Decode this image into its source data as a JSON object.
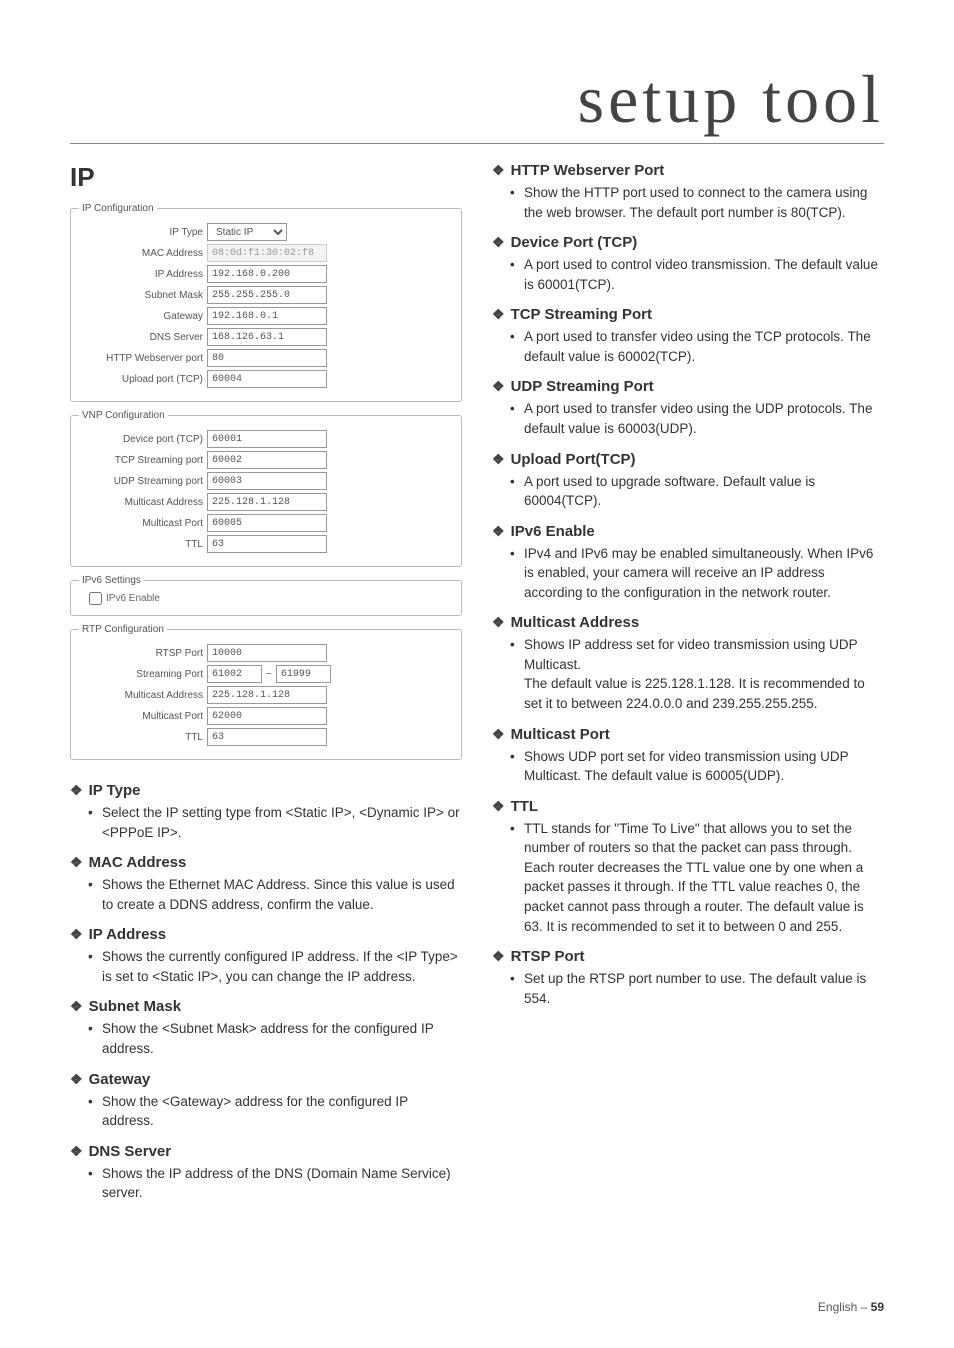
{
  "header": {
    "title": "setup tool"
  },
  "left": {
    "section_title": "IP",
    "ip_config": {
      "legend": "IP Configuration",
      "ip_type_label": "IP Type",
      "ip_type_value": "Static IP",
      "mac_label": "MAC Address",
      "mac_value": "08:0d:f1:30:02:f8",
      "ip_addr_label": "IP Address",
      "ip_addr_value": "192.168.0.200",
      "subnet_label": "Subnet Mask",
      "subnet_value": "255.255.255.0",
      "gateway_label": "Gateway",
      "gateway_value": "192.168.0.1",
      "dns_label": "DNS Server",
      "dns_value": "168.126.63.1",
      "http_label": "HTTP Webserver port",
      "http_value": "80",
      "upload_label": "Upload port (TCP)",
      "upload_value": "60004"
    },
    "vnp_config": {
      "legend": "VNP Configuration",
      "device_port_label": "Device port (TCP)",
      "device_port_value": "60001",
      "tcp_stream_label": "TCP Streaming port",
      "tcp_stream_value": "60002",
      "udp_stream_label": "UDP Streaming port",
      "udp_stream_value": "60003",
      "multicast_addr_label": "Multicast Address",
      "multicast_addr_value": "225.128.1.128",
      "multicast_port_label": "Multicast Port",
      "multicast_port_value": "60005",
      "ttl_label": "TTL",
      "ttl_value": "63"
    },
    "ipv6_config": {
      "legend": "IPv6 Settings",
      "enable_label": "IPv6 Enable"
    },
    "rtp_config": {
      "legend": "RTP Configuration",
      "rtsp_port_label": "RTSP Port",
      "rtsp_port_value": "10000",
      "stream_port_label": "Streaming Port",
      "stream_port_start": "61002",
      "stream_port_end": "61999",
      "multicast_addr_label": "Multicast Address",
      "multicast_addr_value": "225.128.1.128",
      "multicast_port_label": "Multicast Port",
      "multicast_port_value": "62000",
      "ttl_label": "TTL",
      "ttl_value": "63"
    },
    "items": [
      {
        "title": "IP Type",
        "body": "Select the IP setting type from <Static IP>, <Dynamic IP> or <PPPoE IP>."
      },
      {
        "title": "MAC Address",
        "body": "Shows the Ethernet MAC Address. Since this value is used to create a DDNS address, confirm the value."
      },
      {
        "title": "IP Address",
        "body": "Shows the currently configured IP address. If the <IP Type> is set to <Static IP>, you can change the IP address."
      },
      {
        "title": "Subnet Mask",
        "body": "Show the <Subnet Mask> address for the configured IP address."
      },
      {
        "title": "Gateway",
        "body": "Show the <Gateway> address for the configured IP address."
      },
      {
        "title": "DNS Server",
        "body": "Shows the IP address of the DNS (Domain Name Service) server."
      }
    ]
  },
  "right": {
    "items": [
      {
        "title": "HTTP Webserver Port",
        "body": "Show the HTTP port used to connect to the camera using the web browser. The default port number is 80(TCP)."
      },
      {
        "title": "Device Port (TCP)",
        "body": "A port used to control video transmission. The default value is 60001(TCP)."
      },
      {
        "title": "TCP Streaming Port",
        "body": "A port used to transfer video using the TCP protocols. The default value is 60002(TCP)."
      },
      {
        "title": "UDP Streaming Port",
        "body": "A port used to transfer video using the UDP protocols. The default value is 60003(UDP)."
      },
      {
        "title": "Upload Port(TCP)",
        "body": "A port used to upgrade software. Default value is 60004(TCP)."
      },
      {
        "title": "IPv6 Enable",
        "body": "IPv4 and IPv6 may be enabled simultaneously. When IPv6 is enabled, your camera will receive an IP address according to the configuration in the network router."
      },
      {
        "title": "Multicast Address",
        "body": "Shows IP address set for video transmission using UDP Multicast.",
        "body2": "The default value is 225.128.1.128. It is recommended to set it to between 224.0.0.0 and 239.255.255.255."
      },
      {
        "title": "Multicast Port",
        "body": "Shows UDP port set for video transmission using UDP Multicast. The default value is 60005(UDP)."
      },
      {
        "title": "TTL",
        "body": "TTL stands for \"Time To Live\" that allows you to set the number of routers so that the packet can pass through. Each router decreases the TTL value one by one when a packet passes it through. If the TTL value reaches 0, the packet cannot pass through a router. The default value is 63. It is recommended to set it to between 0 and 255."
      },
      {
        "title": "RTSP Port",
        "body": "Set up the RTSP port number to use. The default value is 554."
      }
    ]
  },
  "footer": {
    "lang": "English –",
    "page": "59"
  }
}
